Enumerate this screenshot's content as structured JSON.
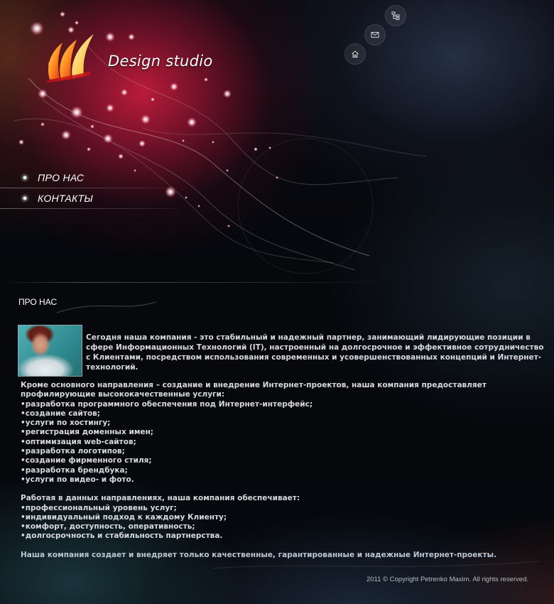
{
  "brand": {
    "name": "Design studio"
  },
  "top_icons": [
    "sitemap-icon",
    "mail-icon",
    "home-icon"
  ],
  "nav": {
    "items": [
      {
        "label": "ПРО НАС"
      },
      {
        "label": "КОНТАКТЫ"
      }
    ]
  },
  "section": {
    "title": "ПРО НАС"
  },
  "content": {
    "intro": "Сегодня наша компания  - это стабильный и надежный партнер, занимающий лидирующие позиции в сфере Информационных Технологий (IT), настроенный на долгосрочное и эффективное сотрудничество с Клиентами, посредством использования современных и усовершенствованных концепций и Интернет-технологий.",
    "services_intro": "Кроме основного направления – создание и внедрение Интернет-проектов, наша компания  предоставляет профилирующие высококачественные услуги:",
    "services": [
      "разработка программного обеспечения под Интернет-интерфейс;",
      "создание сайтов;",
      "услуги по хостингу;",
      "регистрация доменных имен;",
      "оптимизация web-сайтов;",
      "разработка логотипов;",
      "создание фирменного стиля;",
      "разработка брендбука;",
      "услуги по видео- и фото."
    ],
    "benefits_intro": "Работая в данных направлениях, наша компания  обеспечивает:",
    "benefits": [
      "профессиональный уровень услуг;",
      "индивидуальный подход к каждому Клиенту;",
      "комфорт, доступность, оперативность;",
      "долгосрочность и стабильность партнерства."
    ],
    "closing": "Наша компания создает и внедряет только качественные, гарантированные и надежные Интернет-проекты."
  },
  "footer": {
    "copyright": "2011 © Copyright Petrenko Maxim. All rights reserved."
  },
  "colors": {
    "accent": "#c41c3c",
    "text": "#d6d9dc",
    "background": "#04070b"
  }
}
